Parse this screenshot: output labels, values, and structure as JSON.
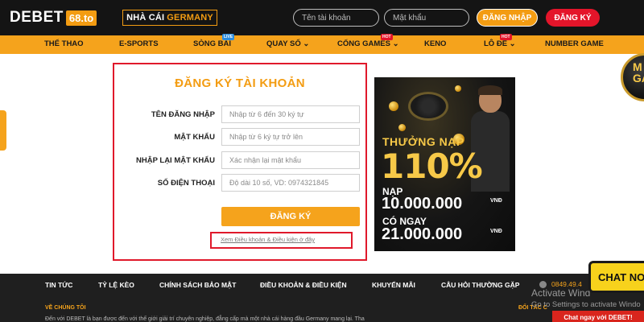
{
  "header": {
    "logo_main": "DEBET",
    "logo_sub": "68.to",
    "brand_badge_prefix": "NHÀ CÁI",
    "brand_badge_highlight": "GERMANY",
    "username_placeholder": "Tên tài khoản",
    "password_placeholder": "Mật khẩu",
    "login_label": "ĐĂNG NHẬP",
    "register_label": "ĐĂNG KÝ"
  },
  "nav": {
    "items": [
      {
        "label": "THỂ THAO"
      },
      {
        "label": "E-SPORTS"
      },
      {
        "label": "SÒNG BÀI",
        "tag": "LIVE"
      },
      {
        "label": "QUAY SỐ ⌄"
      },
      {
        "label": "CỔNG GAMES ⌄",
        "tag": "HOT"
      },
      {
        "label": "KENO"
      },
      {
        "label": "LÔ ĐỀ ⌄",
        "tag": "HOT"
      },
      {
        "label": "NUMBER GAME"
      }
    ]
  },
  "register_form": {
    "title": "ĐĂNG KÝ TÀI KHOẢN",
    "fields": [
      {
        "label": "TÊN ĐĂNG NHẬP",
        "placeholder": "Nhập từ 6 đến 30 ký tự"
      },
      {
        "label": "MẬT KHẨU",
        "placeholder": "Nhập từ 6 ký tự trở lên"
      },
      {
        "label": "NHẬP LẠI MẬT KHẨU",
        "placeholder": "Xác nhận lại mật khẩu"
      },
      {
        "label": "SỐ ĐIỆN THOẠI",
        "placeholder": "Độ dài 10 số, VD: 0974321845"
      }
    ],
    "submit_label": "ĐĂNG KÝ",
    "terms_link": "Xem Điều khoản & Điều kiện ở đây"
  },
  "banner": {
    "line1": "THƯỞNG NẠP",
    "percent": "110%",
    "line3": "NẠP",
    "amount1": "10.000.000",
    "currency": "VNĐ",
    "line5": "CÓ NGAY",
    "amount2": "21.000.000",
    "side_badge": "M\nGA"
  },
  "footer": {
    "links": [
      "TIN TỨC",
      "TỶ LỆ KÈO",
      "CHÍNH SÁCH BẢO MẬT",
      "ĐIỀU KHOẢN & ĐIỀU KIỆN",
      "KHUYẾN MÃI",
      "CÂU HỎI THƯỜNG GẶP"
    ],
    "phone": "0849.49.4",
    "about_title": "VỀ CHÚNG TÔI",
    "intro": "Đến với DEBET là bạn được đến với thế giới giải trí chuyên nghiệp, đẳng cấp mà một nhà cái hàng đầu Germany mang lại. Tha",
    "partner_title": "ĐỐI TÁC C"
  },
  "windows_watermark": {
    "line1": "Activate Wind",
    "line2": "Go to Settings to activate Windo"
  },
  "chat": {
    "bubble": "CHAT NO",
    "bar": "Chat ngay với DEBET!"
  },
  "colors": {
    "accent": "#f39c12",
    "nav_bg": "#f5a31c",
    "top_bg": "#141414",
    "register_red": "#e4152a",
    "highlight_border": "#e0192b"
  }
}
